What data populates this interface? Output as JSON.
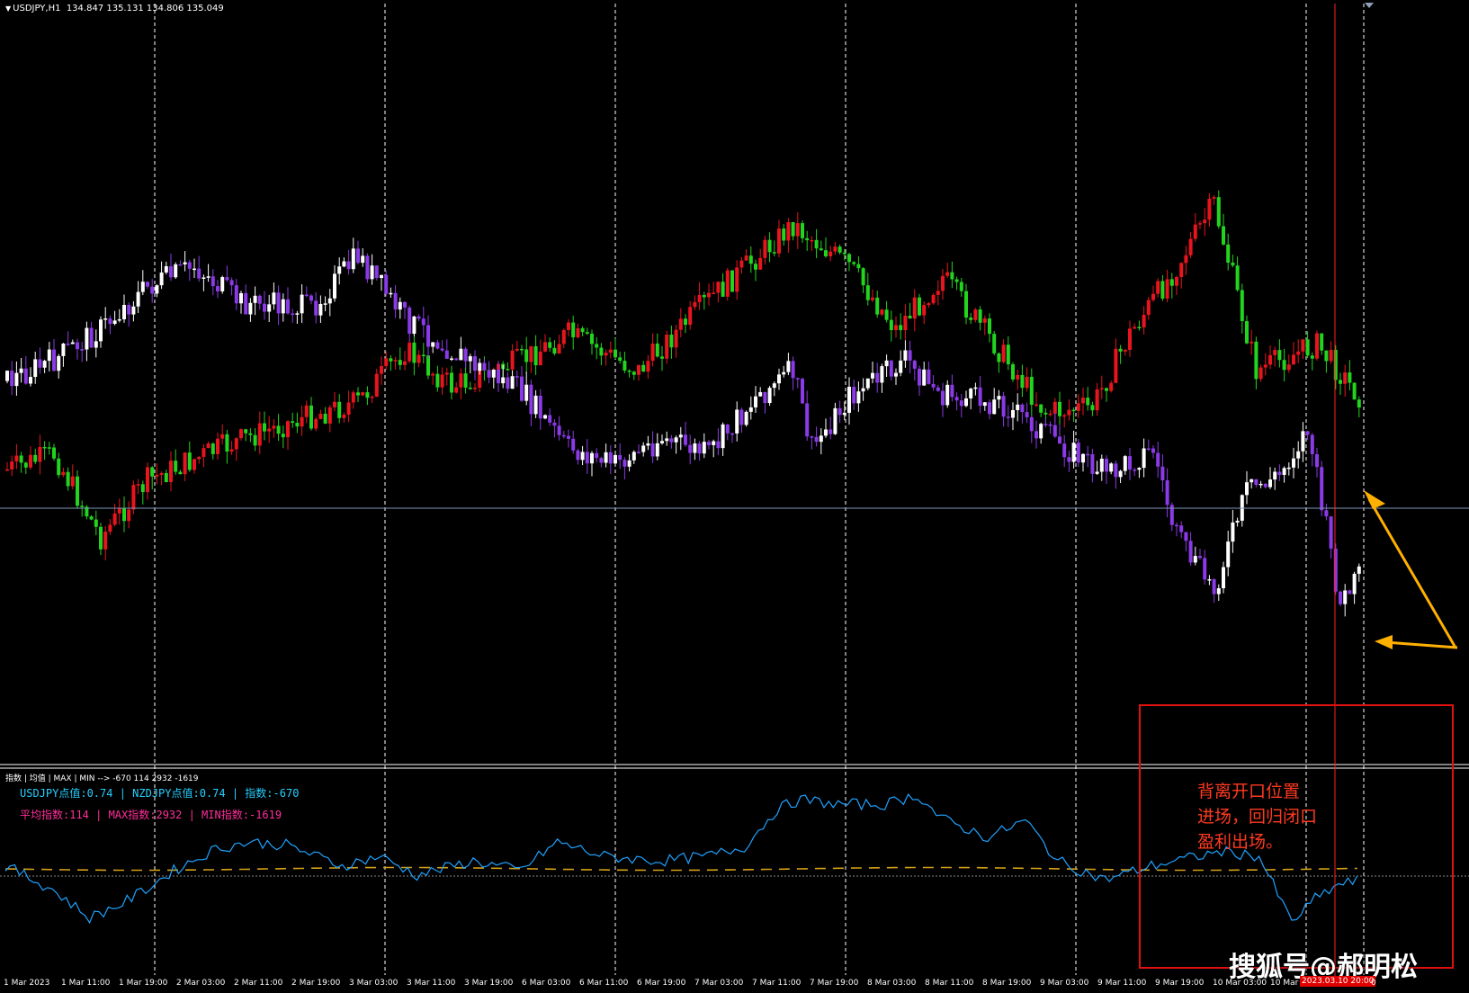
{
  "main_chart": {
    "symbol_label": "USDJPY,H1",
    "ohlc_text": "134.847 135.131 134.806 135.049",
    "header_triangle": "▼"
  },
  "indicator": {
    "header": "指数 | 均值 | MAX | MIN --> -670 114 2932 -1619",
    "line1": "USDJPY点值:0.74 | NZDJPY点值:0.74 | 指数:-670",
    "line2": "平均指数:114 | MAX指数:2932 | MIN指数:-1619"
  },
  "annotation": {
    "lines": [
      "背离开口位置",
      "进场，回归闭口",
      "盈利出场。"
    ]
  },
  "watermark": "搜狐号@郝明松",
  "time_axis": {
    "labels": [
      "1 Mar 2023",
      "1 Mar 11:00",
      "1 Mar 19:00",
      "2 Mar 03:00",
      "2 Mar 11:00",
      "2 Mar 19:00",
      "3 Mar 03:00",
      "3 Mar 11:00",
      "3 Mar 19:00",
      "6 Mar 03:00",
      "6 Mar 11:00",
      "6 Mar 19:00",
      "7 Mar 03:00",
      "7 Mar 11:00",
      "7 Mar 19:00",
      "8 Mar 03:00",
      "8 Mar 11:00",
      "8 Mar 19:00",
      "9 Mar 03:00",
      "9 Mar 11:00",
      "9 Mar 19:00",
      "10 Mar 03:00",
      "10 Mar"
    ],
    "cursor_label": "2023.03.10 20:00",
    "trailing_label": "0"
  },
  "colors": {
    "background": "#000000",
    "usdjpy_up": "#e8141e",
    "usdjpy_down": "#22d41e",
    "nzdjpy_up": "#ffffff",
    "nzdjpy_down": "#8a3ae6",
    "index_line": "#1fa2ff",
    "mean_line": "#d4a017",
    "annotation": "#ff3a20",
    "arrow": "#ffb000",
    "cursor_line": "#ff2020",
    "grid": "#ffffff"
  },
  "chart_data": {
    "type": "candlestick",
    "title": "USDJPY,H1",
    "note_series": [
      "USDJPY (red/green candles)",
      "NZDJPY (white/purple candles)",
      "index (blue line)",
      "mean (gold dashed line)"
    ],
    "price_level_line": 135.049,
    "usdjpy_anchor_path": [
      [
        0,
        0.59
      ],
      [
        10,
        0.56
      ],
      [
        20,
        0.72
      ],
      [
        30,
        0.61
      ],
      [
        45,
        0.55
      ],
      [
        60,
        0.5
      ],
      [
        75,
        0.46
      ],
      [
        85,
        0.36
      ],
      [
        95,
        0.43
      ],
      [
        110,
        0.38
      ],
      [
        120,
        0.33
      ],
      [
        135,
        0.4
      ],
      [
        148,
        0.28
      ],
      [
        158,
        0.2
      ],
      [
        168,
        0.12
      ],
      [
        180,
        0.2
      ],
      [
        190,
        0.32
      ],
      [
        200,
        0.22
      ],
      [
        212,
        0.36
      ],
      [
        222,
        0.48
      ],
      [
        232,
        0.47
      ],
      [
        240,
        0.33
      ],
      [
        250,
        0.2
      ],
      [
        258,
        0.08
      ],
      [
        267,
        0.4
      ],
      [
        280,
        0.35
      ],
      [
        290,
        0.46
      ]
    ],
    "nzdjpy_anchor_path": [
      [
        0,
        0.42
      ],
      [
        10,
        0.38
      ],
      [
        20,
        0.32
      ],
      [
        30,
        0.24
      ],
      [
        40,
        0.2
      ],
      [
        50,
        0.27
      ],
      [
        65,
        0.28
      ],
      [
        75,
        0.18
      ],
      [
        85,
        0.3
      ],
      [
        100,
        0.39
      ],
      [
        110,
        0.44
      ],
      [
        120,
        0.55
      ],
      [
        130,
        0.58
      ],
      [
        140,
        0.53
      ],
      [
        150,
        0.56
      ],
      [
        160,
        0.45
      ],
      [
        168,
        0.4
      ],
      [
        172,
        0.55
      ],
      [
        180,
        0.45
      ],
      [
        192,
        0.38
      ],
      [
        200,
        0.45
      ],
      [
        212,
        0.46
      ],
      [
        222,
        0.52
      ],
      [
        235,
        0.6
      ],
      [
        245,
        0.55
      ],
      [
        250,
        0.72
      ],
      [
        258,
        0.82
      ],
      [
        265,
        0.63
      ],
      [
        272,
        0.6
      ],
      [
        278,
        0.51
      ],
      [
        285,
        0.85
      ],
      [
        290,
        0.78
      ]
    ],
    "index_anchor_path": [
      [
        0,
        0.3
      ],
      [
        10,
        0.05
      ],
      [
        18,
        -0.25
      ],
      [
        25,
        -0.1
      ],
      [
        30,
        0.05
      ],
      [
        36,
        0.25
      ],
      [
        45,
        0.48
      ],
      [
        52,
        0.55
      ],
      [
        60,
        0.52
      ],
      [
        72,
        0.3
      ],
      [
        80,
        0.4
      ],
      [
        88,
        0.2
      ],
      [
        100,
        0.35
      ],
      [
        110,
        0.25
      ],
      [
        118,
        0.55
      ],
      [
        128,
        0.4
      ],
      [
        140,
        0.35
      ],
      [
        150,
        0.4
      ],
      [
        158,
        0.5
      ],
      [
        165,
        0.9
      ],
      [
        170,
        1.0
      ],
      [
        178,
        0.95
      ],
      [
        188,
        0.95
      ],
      [
        195,
        1.05
      ],
      [
        200,
        0.8
      ],
      [
        210,
        0.6
      ],
      [
        218,
        0.78
      ],
      [
        225,
        0.35
      ],
      [
        235,
        0.15
      ],
      [
        245,
        0.3
      ],
      [
        260,
        0.45
      ],
      [
        268,
        0.4
      ],
      [
        275,
        -0.3
      ],
      [
        280,
        -0.05
      ],
      [
        285,
        0.1
      ],
      [
        290,
        0.15
      ]
    ],
    "candle_count": 290
  }
}
